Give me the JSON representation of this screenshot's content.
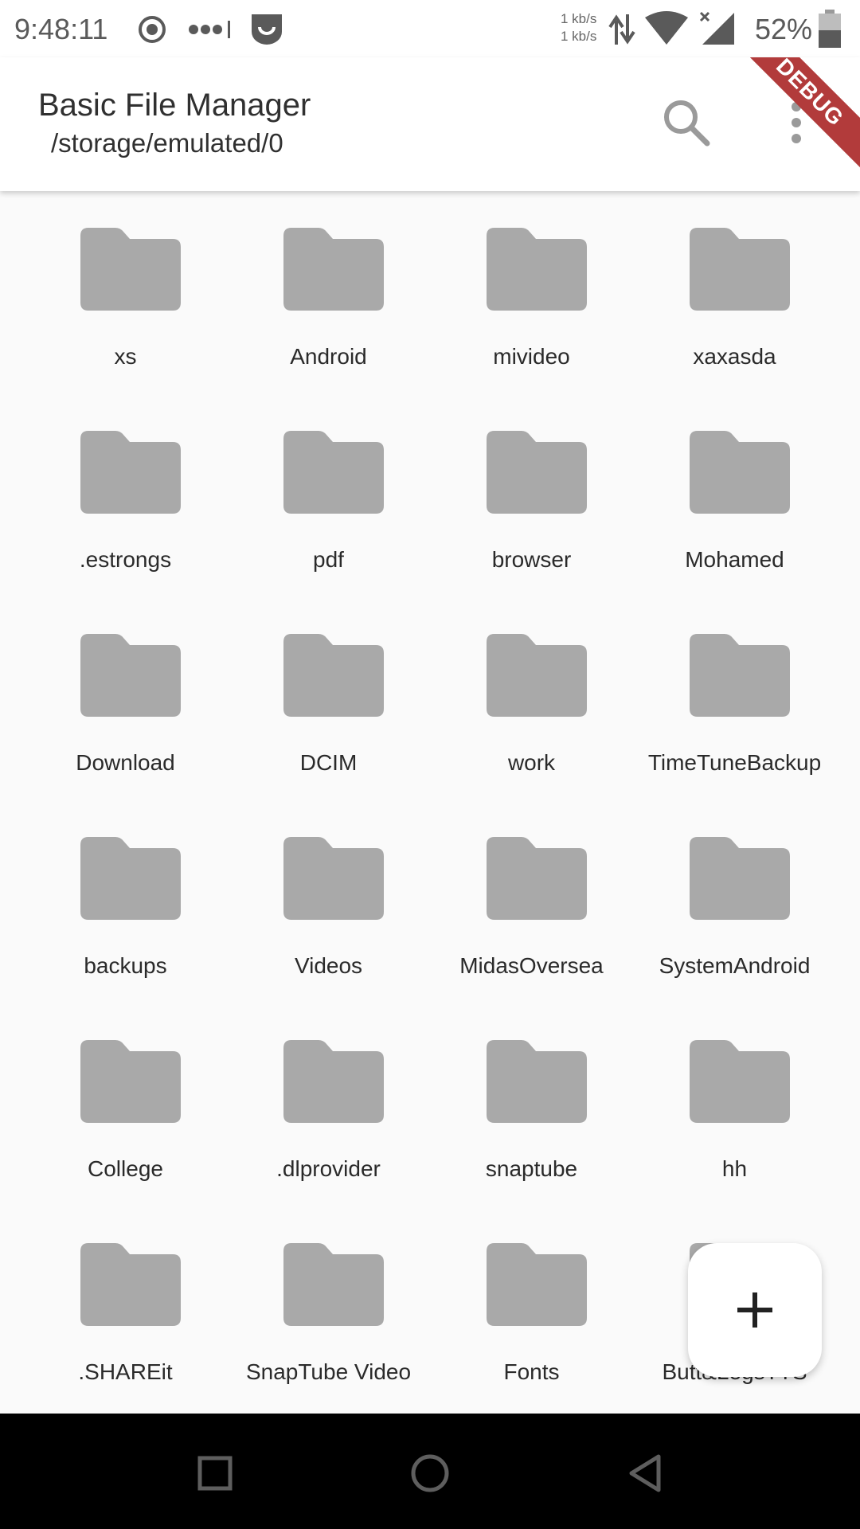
{
  "status_bar": {
    "time": "9:48:11",
    "net_speed_up": "1 kb/s",
    "net_speed_down": "1 kb/s",
    "battery": "52%",
    "icons": [
      "record-icon",
      "signal-dots-icon",
      "app-notification-icon",
      "data-transfer-icon",
      "wifi-icon",
      "cell-signal-icon",
      "battery-icon"
    ]
  },
  "app_bar": {
    "title": "Basic File Manager",
    "path": "/storage/emulated/0",
    "debug_banner": "DEBUG"
  },
  "folders": [
    "xs",
    "Android",
    "mivideo",
    "xaxasda",
    ".estrongs",
    "pdf",
    "browser",
    "Mohamed",
    "Download",
    "DCIM",
    "work",
    "TimeTuneBackup",
    "backups",
    "Videos",
    "MidasOversea",
    "SystemAndroid",
    "College",
    ".dlprovider",
    "snaptube",
    "hh",
    ".SHAREit",
    "SnapTube Video",
    "Fonts",
    "Butt&LegsTTS"
  ],
  "colors": {
    "folder": "#a9a9a9",
    "background": "#fafafa",
    "debug": "#b23b3b"
  }
}
